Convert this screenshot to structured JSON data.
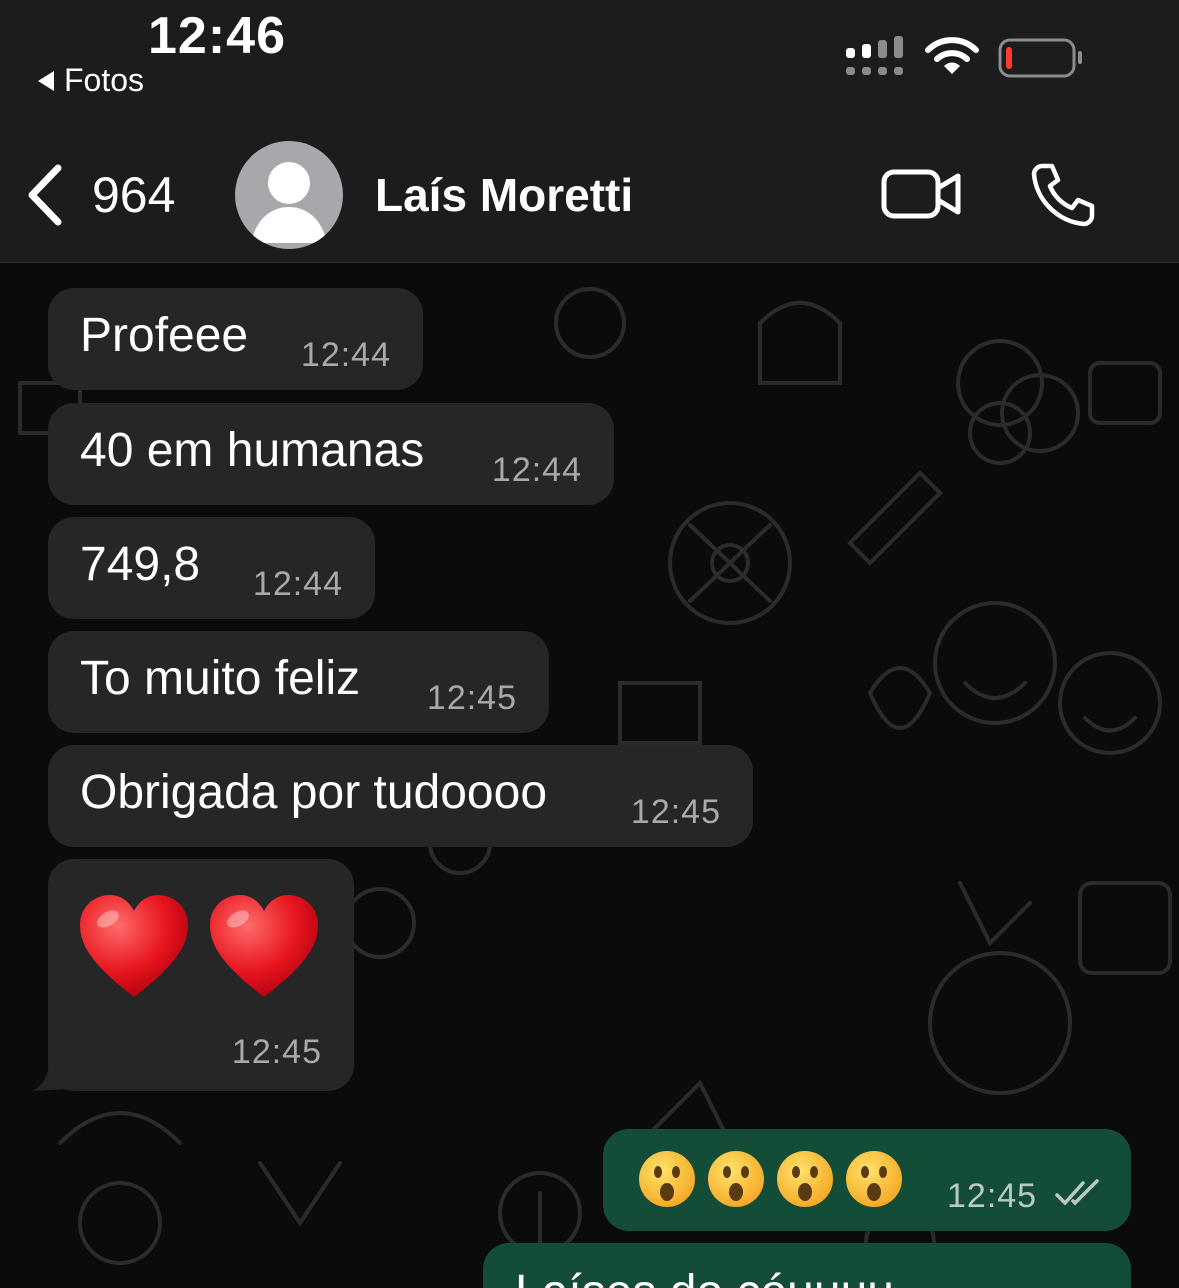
{
  "status_bar": {
    "time": "12:46",
    "back_app": "Fotos",
    "signal_icon": "cellular-signal-icon",
    "wifi_icon": "wifi-icon",
    "battery_icon": "battery-low-icon",
    "battery_accent": "#ff3b30"
  },
  "header": {
    "unread_count": "964",
    "contact_name": "Laís Moretti",
    "avatar_icon": "default-avatar-icon",
    "video_icon": "video-camera-icon",
    "call_icon": "phone-icon"
  },
  "colors": {
    "incoming_bubble": "#262626",
    "outgoing_bubble": "#134d37",
    "background": "#0b0b0b",
    "header": "#1c1c1c"
  },
  "messages": [
    {
      "direction": "incoming",
      "text": "Profeee",
      "time": "12:44"
    },
    {
      "direction": "incoming",
      "text": "40 em humanas",
      "time": "12:44"
    },
    {
      "direction": "incoming",
      "text": "749,8",
      "time": "12:44"
    },
    {
      "direction": "incoming",
      "text": "To muito feliz",
      "time": "12:45"
    },
    {
      "direction": "incoming",
      "text": "Obrigada por tudoooo",
      "time": "12:45"
    },
    {
      "direction": "incoming",
      "content": "two red heart emojis",
      "emoji": "❤️❤️",
      "time": "12:45"
    },
    {
      "direction": "outgoing",
      "content": "four astonished face emojis",
      "emoji": "😮😮😮😮",
      "time": "12:45",
      "status": "read-double-check"
    },
    {
      "direction": "outgoing",
      "text": "Laíses do céuuuu",
      "partially_visible": true
    }
  ]
}
